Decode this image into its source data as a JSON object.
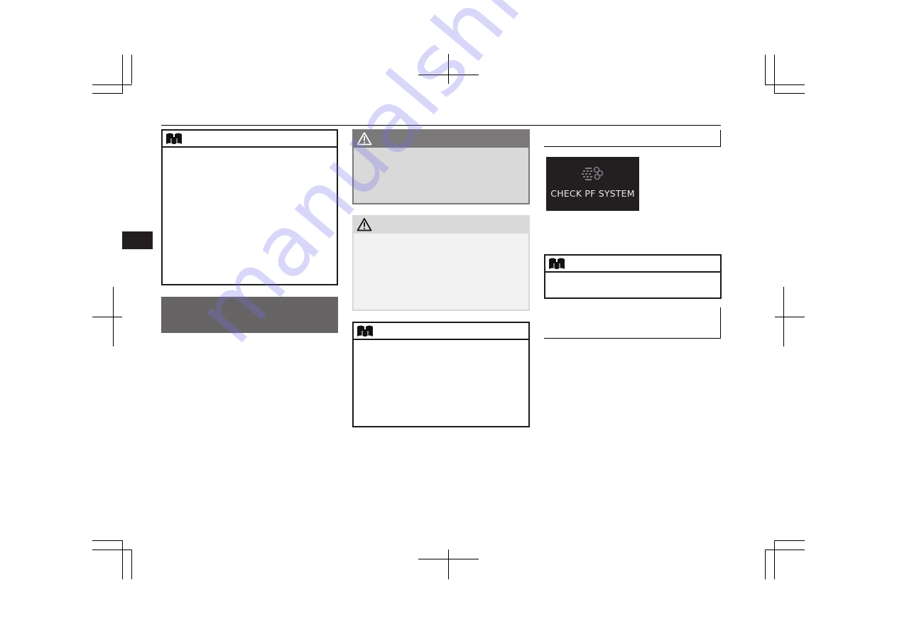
{
  "document": {
    "type": "owner-manual-page",
    "left_column": {
      "note_box": {
        "icon": "book-icon",
        "text": ""
      },
      "section_heading_band": {
        "text": ""
      },
      "chapter_tab": {
        "text": ""
      }
    },
    "middle_column": {
      "warning_box": {
        "icon": "warning-triangle-icon",
        "text": ""
      },
      "caution_box": {
        "icon": "warning-triangle-icon",
        "text": ""
      },
      "note_box": {
        "icon": "book-icon",
        "text": ""
      }
    },
    "right_column": {
      "heading_bar_1": {
        "text": ""
      },
      "display_illustration": {
        "icon": "particulate-filter-warning-icon",
        "message": "CHECK PF SYSTEM"
      },
      "note_box": {
        "icon": "book-icon",
        "text": ""
      },
      "heading_bar_2": {
        "text": ""
      }
    },
    "watermark": {
      "text": "manualshive.com",
      "color": "#786eeb"
    }
  },
  "colors": {
    "warning_header": "#7a7878",
    "warning_body": "#d9d9d9",
    "caution_header": "#d9d9d9",
    "caution_body": "#f1f1f1",
    "heading_band": "#666464",
    "display_bg": "#231f20",
    "display_text": "#e9e9e9"
  }
}
